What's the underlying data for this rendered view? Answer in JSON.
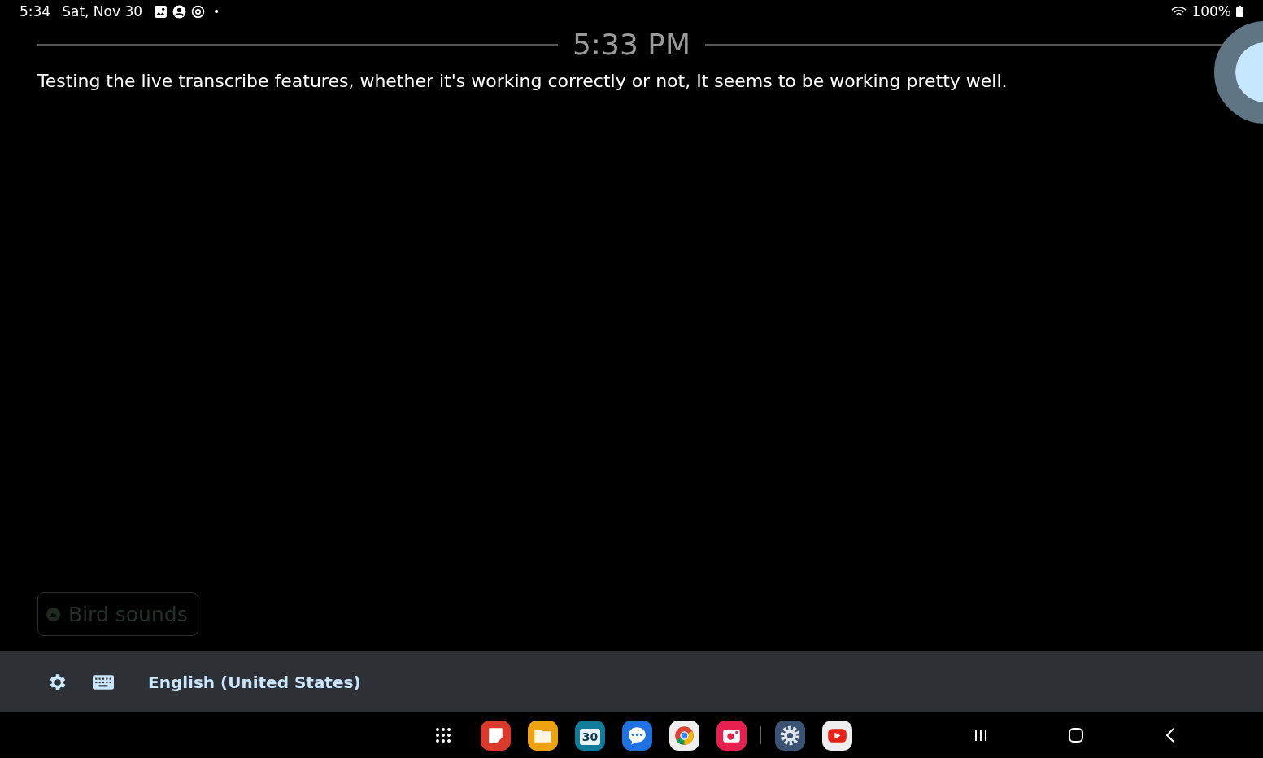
{
  "status_bar": {
    "time": "5:34",
    "date": "Sat, Nov 30",
    "notification_dot": "•",
    "battery": "100%"
  },
  "transcript": {
    "timestamp": "5:33 PM",
    "text": "Testing the live transcribe features, whether it's working correctly or not, It seems to be working pretty well."
  },
  "sound_chip": {
    "label": "Bird sounds"
  },
  "bottom_bar": {
    "language": "English (United States)"
  },
  "dock": [
    {
      "kind": "notes"
    },
    {
      "kind": "files"
    },
    {
      "kind": "calendar",
      "label": "30"
    },
    {
      "kind": "messages"
    },
    {
      "kind": "browser"
    },
    {
      "kind": "camera"
    },
    {
      "kind": "divider"
    },
    {
      "kind": "settings"
    },
    {
      "kind": "video"
    }
  ]
}
